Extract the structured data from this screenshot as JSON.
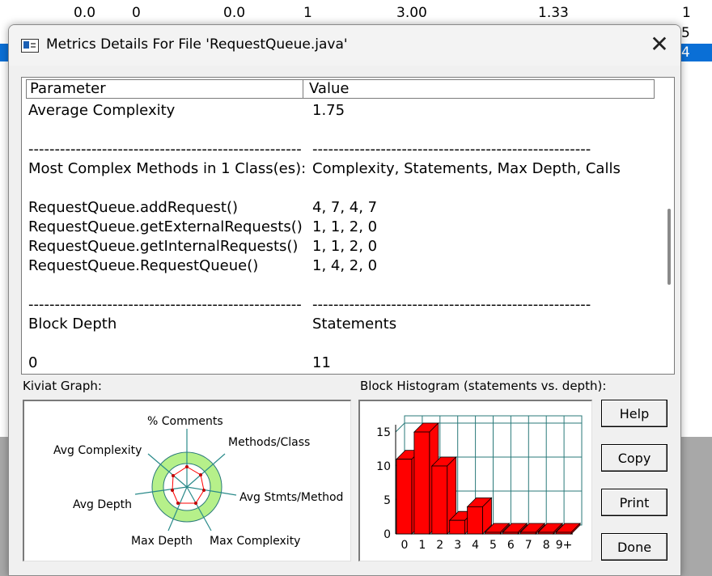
{
  "background": {
    "row_values": [
      "0.0",
      "0",
      "0.0",
      "1",
      "3.00",
      "1.33",
      "1"
    ],
    "side_values": [
      "5",
      "4"
    ]
  },
  "dialog": {
    "title": "Metrics Details For File 'RequestQueue.java'",
    "close_glyph": "✕"
  },
  "table": {
    "headers": {
      "parameter": "Parameter",
      "value": "Value"
    },
    "rows": [
      {
        "p": "Average Complexity",
        "v": "1.75"
      },
      {
        "p": "",
        "v": ""
      },
      {
        "p": "----------------------------------------------------",
        "v": "-----------------------------------------------------"
      },
      {
        "p": "Most Complex Methods in 1 Class(es):",
        "v": "Complexity, Statements, Max Depth, Calls"
      },
      {
        "p": "",
        "v": ""
      },
      {
        "p": "RequestQueue.addRequest()",
        "v": "4, 7, 4, 7"
      },
      {
        "p": "RequestQueue.getExternalRequests()",
        "v": "1, 1, 2, 0"
      },
      {
        "p": "RequestQueue.getInternalRequests()",
        "v": "1, 1, 2, 0"
      },
      {
        "p": "RequestQueue.RequestQueue()",
        "v": "1, 4, 2, 0"
      },
      {
        "p": "",
        "v": ""
      },
      {
        "p": "----------------------------------------------------",
        "v": "-----------------------------------------------------"
      },
      {
        "p": "Block Depth",
        "v": "Statements"
      },
      {
        "p": "",
        "v": ""
      },
      {
        "p": "0",
        "v": "11"
      }
    ]
  },
  "kiviat": {
    "label": "Kiviat Graph:",
    "axes": [
      "% Comments",
      "Methods/Class",
      "Avg Stmts/Method",
      "Max Complexity",
      "Max Depth",
      "Avg Depth",
      "Avg Complexity"
    ]
  },
  "histogram": {
    "label": "Block Histogram (statements vs. depth):",
    "bar_color": "#ff0000"
  },
  "chart_data": {
    "type": "bar",
    "title": "Block Histogram (statements vs. depth):",
    "categories": [
      "0",
      "1",
      "2",
      "3",
      "4",
      "5",
      "6",
      "7",
      "8",
      "9+"
    ],
    "values": [
      11,
      15,
      10,
      2,
      4,
      0,
      0,
      0,
      0,
      0
    ],
    "ylim": [
      0,
      15
    ],
    "yticks": [
      "0",
      "5",
      "10",
      "15"
    ],
    "grid": true
  },
  "buttons": {
    "help": "Help",
    "copy": "Copy",
    "print": "Print",
    "done": "Done"
  }
}
